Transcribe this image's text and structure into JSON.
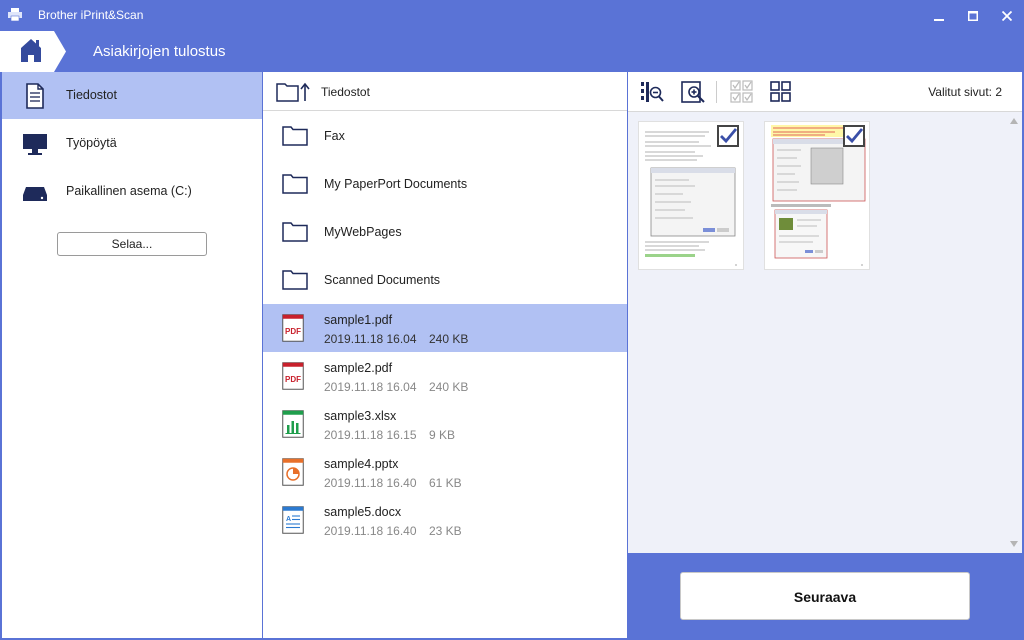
{
  "window": {
    "title": "Brother iPrint&Scan"
  },
  "nav": {
    "breadcrumb": "Asiakirjojen tulostus"
  },
  "colors": {
    "accent": "#5a73d6",
    "selection": "#b1c1f3",
    "pdf": "#c8202c",
    "xlsx": "#1f9e4c",
    "pptx": "#e8702a",
    "docx": "#2b7ad1"
  },
  "sidebar": {
    "items": [
      {
        "label": "Tiedostot",
        "icon": "document-icon",
        "active": true
      },
      {
        "label": "Työpöytä",
        "icon": "monitor-icon",
        "active": false
      },
      {
        "label": "Paikallinen asema (C:)",
        "icon": "drive-icon",
        "active": false
      }
    ],
    "browse_label": "Selaa..."
  },
  "files": {
    "header": "Tiedostot",
    "folders": [
      "Fax",
      "My PaperPort Documents",
      "MyWebPages",
      "Scanned Documents"
    ],
    "items": [
      {
        "name": "sample1.pdf",
        "date": "2019.11.18 16.04",
        "size": "240 KB",
        "type": "pdf",
        "selected": true
      },
      {
        "name": "sample2.pdf",
        "date": "2019.11.18 16.04",
        "size": "240 KB",
        "type": "pdf",
        "selected": false
      },
      {
        "name": "sample3.xlsx",
        "date": "2019.11.18 16.15",
        "size": "9 KB",
        "type": "xlsx",
        "selected": false
      },
      {
        "name": "sample4.pptx",
        "date": "2019.11.18 16.40",
        "size": "61 KB",
        "type": "pptx",
        "selected": false
      },
      {
        "name": "sample5.docx",
        "date": "2019.11.18 16.40",
        "size": "23 KB",
        "type": "docx",
        "selected": false
      }
    ]
  },
  "preview": {
    "selected_pages": "Valitut sivut: 2",
    "pages": [
      {
        "checked": true
      },
      {
        "checked": true
      }
    ]
  },
  "footer": {
    "next_label": "Seuraava"
  }
}
